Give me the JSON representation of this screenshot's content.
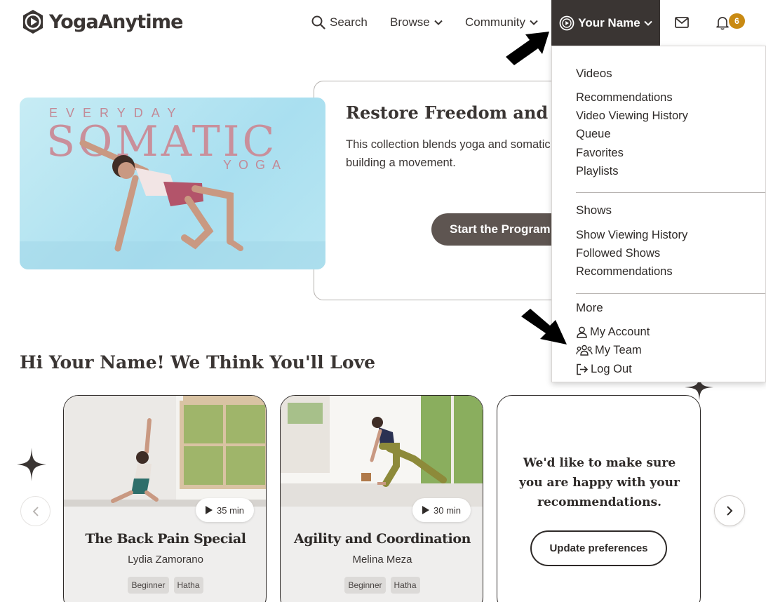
{
  "brand": {
    "name": "YogaAnytime",
    "logo_icon": "play-circle-logo",
    "accent": "#c98a12",
    "dark": "#3a3533"
  },
  "header": {
    "search_label": "Search",
    "browse_label": "Browse",
    "community_label": "Community",
    "user_label": "Your Name",
    "notification_count": "6"
  },
  "hero": {
    "image_text_top": "EVERYDAY",
    "image_text_main": "SOMATIC",
    "image_text_bottom": "YOGA",
    "title": "Restore Freedom and Ea",
    "description": "This collection blends yoga and somatic underused areas of the body, building a movement.",
    "cta_label": "Start the Program"
  },
  "recommendations": {
    "heading": "Hi Your Name! We Think You'll Love",
    "cards": [
      {
        "title": "The Back Pain Special",
        "author": "Lydia Zamorano",
        "duration": "35 min",
        "tags": [
          "Beginner",
          "Hatha"
        ]
      },
      {
        "title": "Agility and Coordination",
        "author": "Melina Meza",
        "duration": "30 min",
        "tags": [
          "Beginner",
          "Hatha"
        ]
      }
    ],
    "feedback_text": "We'd like to make sure you are happy with your recommendations.",
    "feedback_button": "Update preferences"
  },
  "dropdown": {
    "videos_heading": "Videos",
    "videos_items": [
      "Recommendations",
      "Video Viewing History",
      "Queue",
      "Favorites",
      "Playlists"
    ],
    "shows_heading": "Shows",
    "shows_items": [
      "Show Viewing History",
      "Followed Shows",
      "Recommendations"
    ],
    "more_heading": "More",
    "more_items": [
      {
        "label": "My Account",
        "icon": "user-icon"
      },
      {
        "label": "My Team",
        "icon": "team-icon"
      },
      {
        "label": "Log Out",
        "icon": "logout-icon"
      }
    ]
  }
}
